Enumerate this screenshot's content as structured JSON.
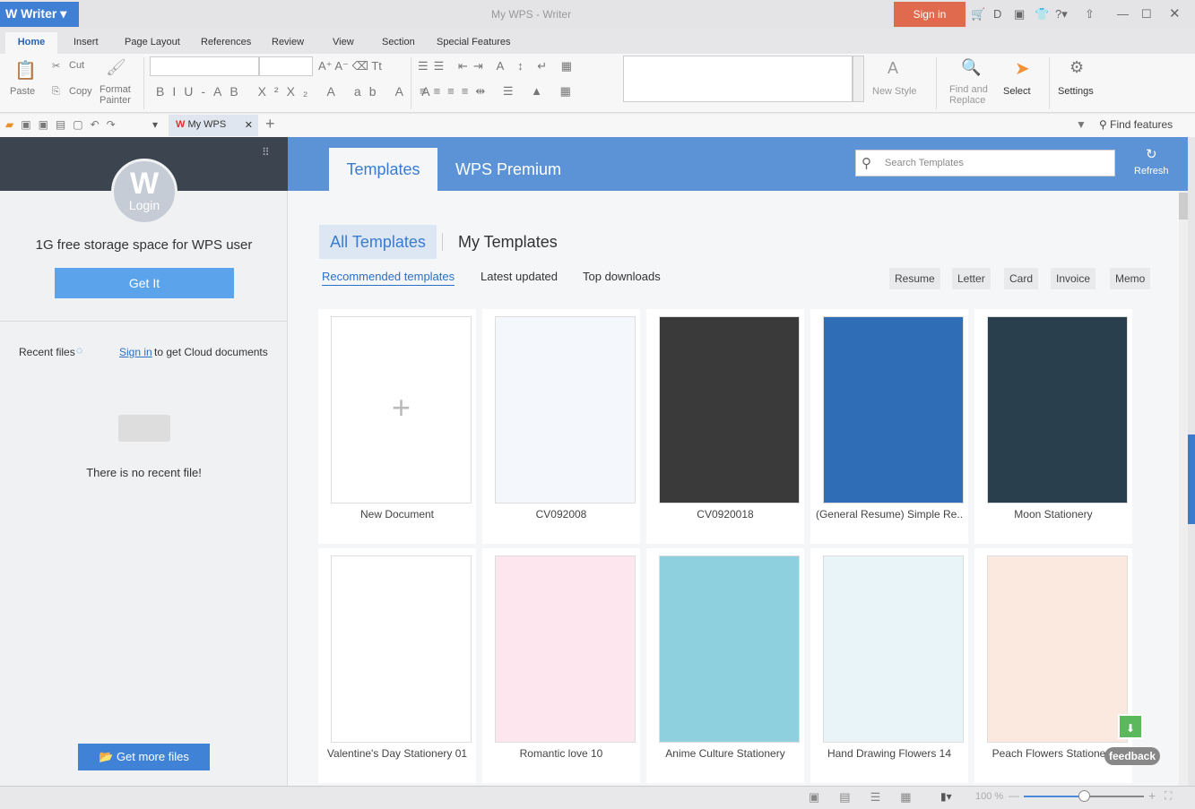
{
  "app": {
    "name": "Writer",
    "title": "My WPS - Writer",
    "sign_in": "Sign in"
  },
  "menu_tabs": [
    "Home",
    "Insert",
    "Page Layout",
    "References",
    "Review",
    "View",
    "Section",
    "Special Features"
  ],
  "ribbon": {
    "paste": "Paste",
    "cut": "Cut",
    "copy": "Copy",
    "format_painter_1": "Format",
    "format_painter_2": "Painter",
    "new_style": "New Style",
    "find_replace_1": "Find and",
    "find_replace_2": "Replace",
    "select": "Select",
    "settings": "Settings"
  },
  "quick": {
    "doc_tab": "My WPS",
    "find_features": "Find features"
  },
  "left": {
    "login": "Login",
    "storage": "1G free storage space for WPS user",
    "get_it": "Get It",
    "recent_files": "Recent files",
    "sign_in_link": "Sign in",
    "cloud_text": "to get Cloud documents",
    "no_recent": "There is no recent file!",
    "get_more": "Get more files"
  },
  "main": {
    "tabs": [
      "Templates",
      "WPS Premium"
    ],
    "search_placeholder": "Search Templates",
    "refresh": "Refresh",
    "all_templates": "All Templates",
    "my_templates": "My Templates",
    "subtabs": [
      "Recommended templates",
      "Latest updated",
      "Top downloads"
    ],
    "categories": [
      "Resume",
      "Letter",
      "Card",
      "Invoice",
      "Memo"
    ],
    "templates": [
      {
        "name": "New Document",
        "color": "#ffffff"
      },
      {
        "name": "CV092008",
        "color": "#f4f7fb"
      },
      {
        "name": "CV0920018",
        "color": "#3a3a3a"
      },
      {
        "name": "(General Resume) Simple Re..",
        "color": "#2f6db6"
      },
      {
        "name": "Moon Stationery",
        "color": "#2a3f4e"
      },
      {
        "name": "Valentine's Day Stationery 01",
        "color": "#ffffff"
      },
      {
        "name": "Romantic love 10",
        "color": "#fde6ee"
      },
      {
        "name": "Anime Culture Stationery",
        "color": "#8fd0df"
      },
      {
        "name": "Hand Drawing Flowers 14",
        "color": "#e8f4f8"
      },
      {
        "name": "Peach Flowers Stationery",
        "color": "#fbe9df"
      }
    ],
    "feedback": "feedback"
  },
  "status": {
    "zoom": "100 %"
  }
}
